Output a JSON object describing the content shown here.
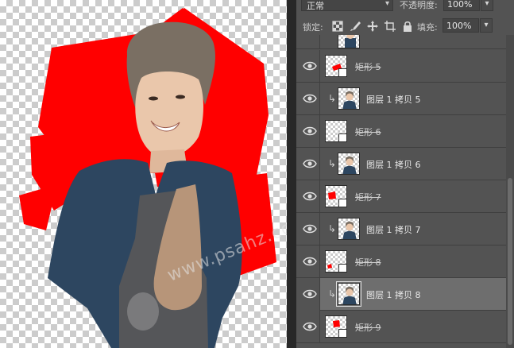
{
  "watermark": "www.psahz.com",
  "colors": {
    "accent_red": "#ff0000",
    "panel_bg": "#535353",
    "selected_row": "#6e6e6e"
  },
  "panel": {
    "blend_mode": "正常",
    "opacity_label": "不透明度:",
    "opacity_value": "100%",
    "lock_label": "锁定:",
    "lock_icons": [
      "lock-transparent-pixels-icon",
      "lock-image-pixels-icon",
      "lock-position-icon",
      "lock-artboard-icon",
      "lock-all-icon"
    ],
    "fill_label": "填充:",
    "fill_value": "100%"
  },
  "layers": [
    {
      "name": "",
      "type": "partial"
    },
    {
      "name": "矩形 5",
      "type": "shape",
      "strike": true
    },
    {
      "name": "图层 1 拷贝 5",
      "type": "photo",
      "clipped": true
    },
    {
      "name": "矩形 6",
      "type": "shape",
      "strike": true
    },
    {
      "name": "图层 1 拷贝 6",
      "type": "photo",
      "clipped": true
    },
    {
      "name": "矩形 7",
      "type": "shape",
      "strike": true
    },
    {
      "name": "图层 1 拷贝 7",
      "type": "photo",
      "clipped": true
    },
    {
      "name": "矩形 8",
      "type": "shape",
      "strike": true
    },
    {
      "name": "图层 1 拷贝 8",
      "type": "photo",
      "clipped": true,
      "selected": true
    },
    {
      "name": "矩形 9",
      "type": "shape",
      "strike": true
    }
  ]
}
